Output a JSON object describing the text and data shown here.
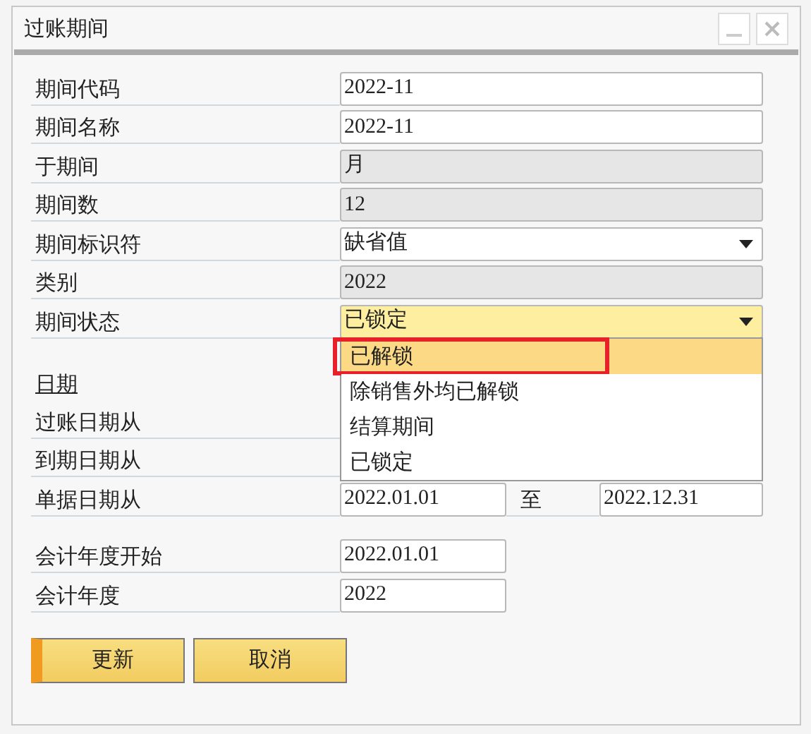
{
  "window": {
    "title": "过账期间"
  },
  "fields": [
    {
      "label": "期间代码",
      "value": "2022-11",
      "kind": "text"
    },
    {
      "label": "期间名称",
      "value": "2022-11",
      "kind": "text"
    },
    {
      "label": "于期间",
      "value": "月",
      "kind": "readonly"
    },
    {
      "label": "期间数",
      "value": "12",
      "kind": "readonly"
    },
    {
      "label": "期间标识符",
      "value": "缺省值",
      "kind": "select",
      "focused": false
    },
    {
      "label": "类别",
      "value": "2022",
      "kind": "readonly"
    },
    {
      "label": "期间状态",
      "value": "已锁定",
      "kind": "select",
      "focused": true
    }
  ],
  "status_dropdown": {
    "options": [
      {
        "label": "已解锁",
        "selected": true,
        "marked": true
      },
      {
        "label": "除销售外均已解锁",
        "selected": false,
        "marked": false
      },
      {
        "label": "结算期间",
        "selected": false,
        "marked": false
      },
      {
        "label": "已锁定",
        "selected": false,
        "marked": false
      }
    ]
  },
  "dates": {
    "heading": "日期",
    "posting_from": "过账日期从",
    "due_from": "到期日期从",
    "document_from": {
      "label": "单据日期从",
      "value": "2022.01.01"
    },
    "document_to": {
      "label": "至",
      "value": "2022.12.31"
    }
  },
  "fiscal": [
    {
      "label": "会计年度开始",
      "value": "2022.01.01"
    },
    {
      "label": "会计年度",
      "value": "2022"
    }
  ],
  "buttons": [
    {
      "label": "更新",
      "primary": true
    },
    {
      "label": "取消",
      "primary": false
    }
  ]
}
